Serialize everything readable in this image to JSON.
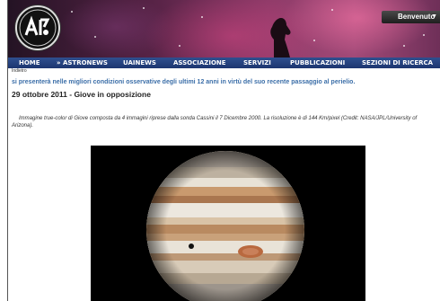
{
  "header": {
    "welcome_menu": "Benvenuto",
    "caret": "▼"
  },
  "nav": {
    "items": [
      {
        "label": "HOME"
      },
      {
        "label": "ASTRONEWS"
      },
      {
        "label": "UAINEWS"
      },
      {
        "label": "ASSOCIAZIONE"
      },
      {
        "label": "SERVIZI"
      },
      {
        "label": "PUBBLICAZIONI"
      },
      {
        "label": "SEZIONI DI RICERCA"
      }
    ],
    "astronews_arrow": "»"
  },
  "breadcrumb": "Indietro",
  "article": {
    "intro": "si presenterà nelle migliori condizioni osservative degli ultimi 12 anni in virtù del suo recente passaggio al perielio.",
    "title": "29 ottobre 2011 - Giove in opposizione",
    "caption": "Immagine true-color di Giove composta da 4 immagini riprese dalla sonda Cassini il 7 Dicembre 2000. La risoluzione è di 144 Km/pixel (Credit: NASA/JPL/University of Arizona)."
  },
  "colors": {
    "nav_bg": "#1d3670",
    "intro_text": "#3b6ea8"
  }
}
